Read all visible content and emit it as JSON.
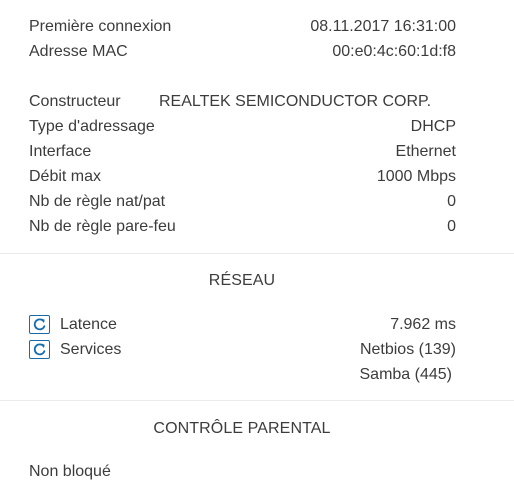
{
  "info": {
    "first_connection": {
      "label": "Première connexion",
      "value": "08.11.2017 16:31:00"
    },
    "mac_address": {
      "label": "Adresse MAC",
      "value": "00:e0:4c:60:1d:f8"
    }
  },
  "details": {
    "manufacturer": {
      "label": "Constructeur",
      "value": "REALTEK SEMICONDUCTOR CORP."
    },
    "addressing_type": {
      "label": "Type d'adressage",
      "value": "DHCP"
    },
    "interface": {
      "label": "Interface",
      "value": "Ethernet"
    },
    "max_rate": {
      "label": "Débit max",
      "value": "1000 Mbps"
    },
    "nat_rules": {
      "label": "Nb de règle nat/pat",
      "value": "0"
    },
    "firewall_rules": {
      "label": "Nb de règle pare-feu",
      "value": "0"
    }
  },
  "network": {
    "title": "RÉSEAU",
    "latency": {
      "label": "Latence",
      "value": "7.962 ms",
      "icon": "refresh-icon"
    },
    "services": {
      "label": "Services",
      "icon": "refresh-icon",
      "items": [
        "Netbios (139)",
        "Samba (445)"
      ]
    }
  },
  "parental": {
    "title": "CONTRÔLE PARENTAL",
    "status": "Non bloqué"
  },
  "colors": {
    "text": "#3c3c3c",
    "icon_accent": "#1a6aa8",
    "divider": "#ececec"
  }
}
